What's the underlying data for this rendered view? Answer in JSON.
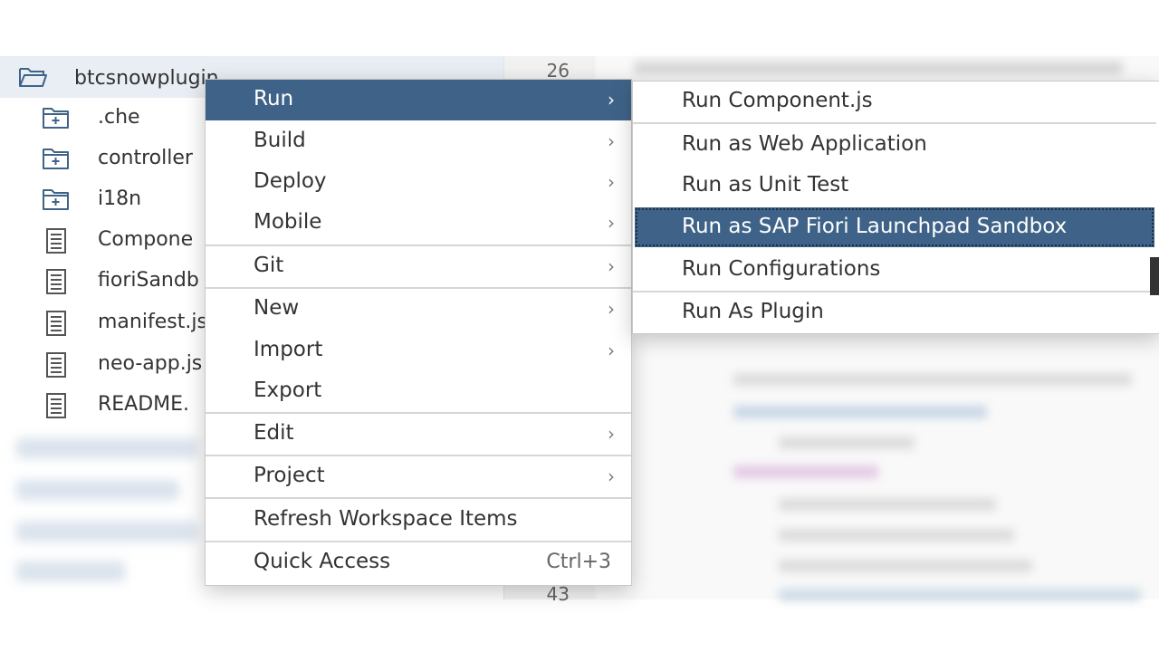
{
  "tree": {
    "root": {
      "label": "btcsnowplugin",
      "icon": "folder-open-icon"
    },
    "items": [
      {
        "label": ".che",
        "icon": "folder-icon"
      },
      {
        "label": "controller",
        "icon": "folder-icon"
      },
      {
        "label": "i18n",
        "icon": "folder-icon"
      },
      {
        "label": "Compone",
        "icon": "file-icon"
      },
      {
        "label": "fioriSandb",
        "icon": "file-icon"
      },
      {
        "label": "manifest.js",
        "icon": "file-icon"
      },
      {
        "label": "neo-app.js",
        "icon": "file-icon"
      },
      {
        "label": "README.",
        "icon": "file-icon"
      }
    ]
  },
  "gutter": {
    "top_line": "26",
    "bottom_line": "43"
  },
  "context_menu": {
    "items": [
      {
        "label": "Run",
        "submenu": true,
        "active": true
      },
      {
        "label": "Build",
        "submenu": true
      },
      {
        "label": "Deploy",
        "submenu": true
      },
      {
        "label": "Mobile",
        "submenu": true
      },
      {
        "label": "Git",
        "submenu": true
      },
      {
        "label": "New",
        "submenu": true
      },
      {
        "label": "Import",
        "submenu": true
      },
      {
        "label": "Export",
        "submenu": false
      },
      {
        "label": "Edit",
        "submenu": true
      },
      {
        "label": "Project",
        "submenu": true
      },
      {
        "label": "Refresh Workspace Items",
        "submenu": false
      },
      {
        "label": "Quick Access",
        "shortcut": "Ctrl+3"
      }
    ]
  },
  "run_submenu": {
    "items": [
      {
        "label": "Run Component.js"
      },
      {
        "label": "Run as Web Application"
      },
      {
        "label": "Run as Unit Test"
      },
      {
        "label": "Run as SAP Fiori Launchpad Sandbox",
        "active": true
      },
      {
        "label": "Run Configurations"
      },
      {
        "label": "Run As Plugin"
      }
    ]
  },
  "colors": {
    "highlight": "#3f6388",
    "menu_text": "#333333",
    "root_row_bg": "#e9eef4"
  }
}
